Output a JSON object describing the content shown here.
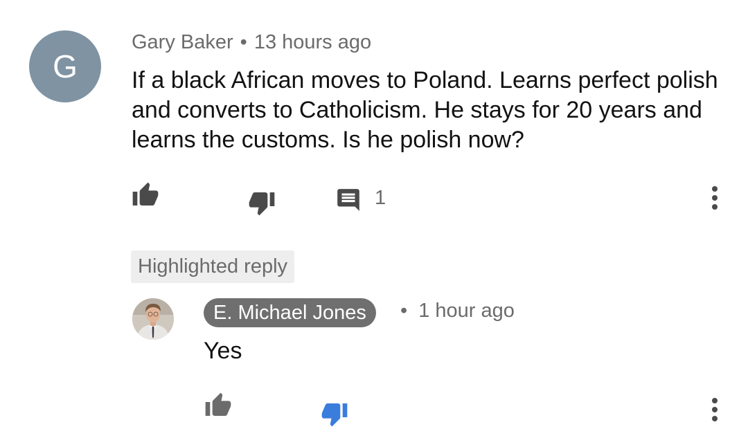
{
  "colors": {
    "avatar_bg": "#7f93a3",
    "icon_gray": "#6b6b6b",
    "icon_dark": "#4a4a4a",
    "dislike_active": "#3b7ddd",
    "name_chip_bg": "#6f6f6f",
    "badge_bg": "#eeeeee"
  },
  "comment": {
    "avatar_letter": "G",
    "author": "Gary Baker",
    "separator": "•",
    "time": "13 hours ago",
    "text": "If a black African moves to Poland. Learns perfect polish and converts to Catholicism. He stays for 20 years and learns the customs. Is he polish now?",
    "reply_count": "1"
  },
  "highlighted_label": "Highlighted reply",
  "reply": {
    "author": "E. Michael Jones",
    "separator": "•",
    "time": "1 hour ago",
    "text": "Yes"
  }
}
